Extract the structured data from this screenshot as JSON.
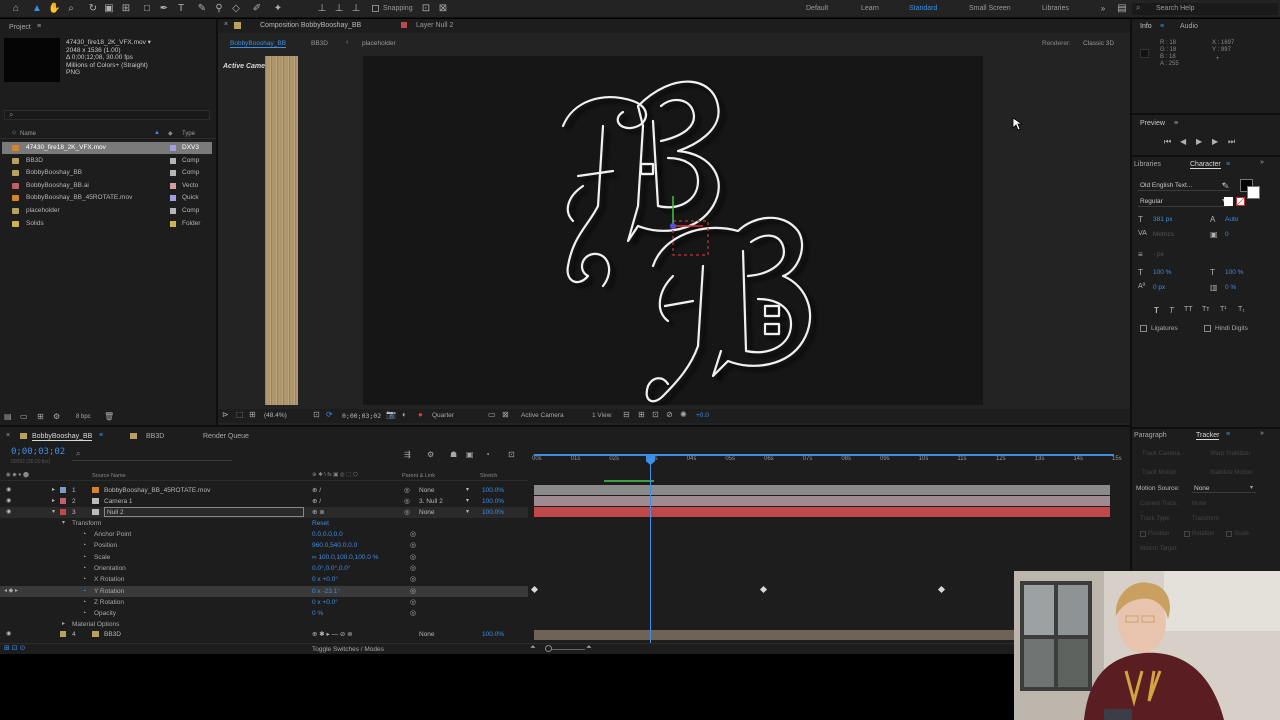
{
  "toolbar": {
    "snapping": "Snapping",
    "workspaces": [
      "Default",
      "Learn",
      "Standard",
      "Small Screen",
      "Libraries"
    ],
    "active_workspace": "Standard",
    "search_placeholder": "Search Help"
  },
  "project": {
    "panel_title": "Project",
    "selected_file": {
      "name": "47430_fire18_2K_VFX.mov",
      "dims": "2048 x 1536 (1.00)",
      "duration": "Δ 0;00;12;08, 30.00 fps",
      "colors": "Millions of Colors+ (Straight)",
      "codec": "PNG"
    },
    "search_placeholder": "",
    "col_name": "Name",
    "col_type": "Type",
    "items": [
      {
        "name": "47430_fire18_2K_VFX.mov",
        "type": "DXV3",
        "color": "#d8822a",
        "label": "#a0a0e0",
        "selected": true
      },
      {
        "name": "BB3D",
        "type": "Comp",
        "color": "#b8a060",
        "label": "#b5b5b5",
        "selected": false
      },
      {
        "name": "BobbyBooshay_BB",
        "type": "Comp",
        "color": "#b8a060",
        "label": "#b5b5b5",
        "selected": false
      },
      {
        "name": "BobbyBooshay_BB.ai",
        "type": "Vecto",
        "color": "#c06060",
        "label": "#d0a0a0",
        "selected": false
      },
      {
        "name": "BobbyBooshay_BB_45ROTATE.mov",
        "type": "Quick",
        "color": "#d8822a",
        "label": "#a0a0e0",
        "selected": false
      },
      {
        "name": "placeholder",
        "type": "Comp",
        "color": "#b8a060",
        "label": "#b5b5b5",
        "selected": false
      },
      {
        "name": "Solids",
        "type": "Folder",
        "color": "#d4b050",
        "label": "#d4b050",
        "selected": false
      }
    ],
    "bpc": "8 bpc"
  },
  "viewer": {
    "comp_tab": "Composition BobbyBooshay_BB",
    "layer_tab": "Layer Null 2",
    "breadcrumbs": [
      "BobbyBooshay_BB",
      "BB3D",
      "placeholder"
    ],
    "renderer_label": "Renderer:",
    "renderer": "Classic 3D",
    "active_camera": "Active Camera",
    "zoom": "(48.4%)",
    "timecode": "0;00;03;02",
    "resolution": "Quarter",
    "camera_view": "Active Camera",
    "views": "1 View",
    "exposure": "+0.0"
  },
  "info": {
    "tab_info": "Info",
    "tab_audio": "Audio",
    "r": "R : 18",
    "g": "G : 18",
    "b": "B : 18",
    "a": "A : 255",
    "x": "X : 1697",
    "y": "Y : 997"
  },
  "preview": {
    "title": "Preview"
  },
  "character": {
    "tab_libraries": "Libraries",
    "tab_character": "Character",
    "font": "Old English Text...",
    "style": "Regular",
    "size": "381 px",
    "leading": "Auto",
    "kerning": "Metrics",
    "tracking": "0",
    "stroke": "- px",
    "vscale": "100 %",
    "hscale": "100 %",
    "baseline": "0 px",
    "tsume": "0 %",
    "ligatures": "Ligatures",
    "hindi": "Hindi Digits"
  },
  "tracker": {
    "tab_paragraph": "Paragraph",
    "tab_tracker": "Tracker",
    "buttons": [
      "Track Camera",
      "Warp Stabilizer",
      "Track Motion",
      "Stabilize Motion"
    ],
    "motion_source_label": "Motion Source:",
    "motion_source": "None",
    "current_track": "Current Track:",
    "current_track_val": "None",
    "track_type": "Track Type:",
    "track_type_val": "Transform",
    "options": [
      "Position",
      "Rotation",
      "Scale"
    ],
    "motion_target": "Motion Target:"
  },
  "timeline": {
    "tabs": [
      "BobbyBooshay_BB",
      "BB3D",
      "Render Queue"
    ],
    "timecode": "0;00;03;02",
    "frames": "00092 (30.00 fps)",
    "col_source": "Source Name",
    "col_parent": "Parent & Link",
    "col_stretch": "Stretch",
    "ruler": [
      "00s",
      "01s",
      "02s",
      "03s",
      "04s",
      "05s",
      "06s",
      "07s",
      "08s",
      "09s",
      "10s",
      "11s",
      "12s",
      "13s",
      "14s",
      "15s"
    ],
    "layers": [
      {
        "num": "1",
        "name": "BobbyBooshay_BB_45ROTATE.mov",
        "parent": "None",
        "stretch": "100.0%",
        "color": "#7a9ac8"
      },
      {
        "num": "2",
        "name": "Camera 1",
        "parent": "3. Null 2",
        "stretch": "100.0%",
        "color": "#c06070"
      },
      {
        "num": "3",
        "name": "Null 2",
        "parent": "None",
        "stretch": "100.0%",
        "color": "#c04848"
      }
    ],
    "transform_label": "Transform",
    "reset": "Reset",
    "props": [
      {
        "name": "Anchor Point",
        "value": "0.0,0.0,0.0"
      },
      {
        "name": "Position",
        "value": "960.0,540.0,0.0"
      },
      {
        "name": "Scale",
        "value": "∞ 100.0,100.0,100.0 %"
      },
      {
        "name": "Orientation",
        "value": "0.0°,0.0°,0.0°"
      },
      {
        "name": "X Rotation",
        "value": "0 x +0.0°"
      },
      {
        "name": "Y Rotation",
        "value": "0 x -23.1°"
      },
      {
        "name": "Z Rotation",
        "value": "0 x +0.0°"
      },
      {
        "name": "Opacity",
        "value": "0 %"
      }
    ],
    "material_options": "Material Options",
    "layer4": {
      "num": "4",
      "name": "BB3D",
      "parent": "None",
      "stretch": "100.0%"
    },
    "toggle": "Toggle Switches / Modes"
  },
  "colors": {
    "accent": "#3d8ee6",
    "panel": "#1d1d1d",
    "null_bar": "#c04848",
    "camera_bar": "#9e8a90",
    "video_bar": "#8a8a8a"
  }
}
